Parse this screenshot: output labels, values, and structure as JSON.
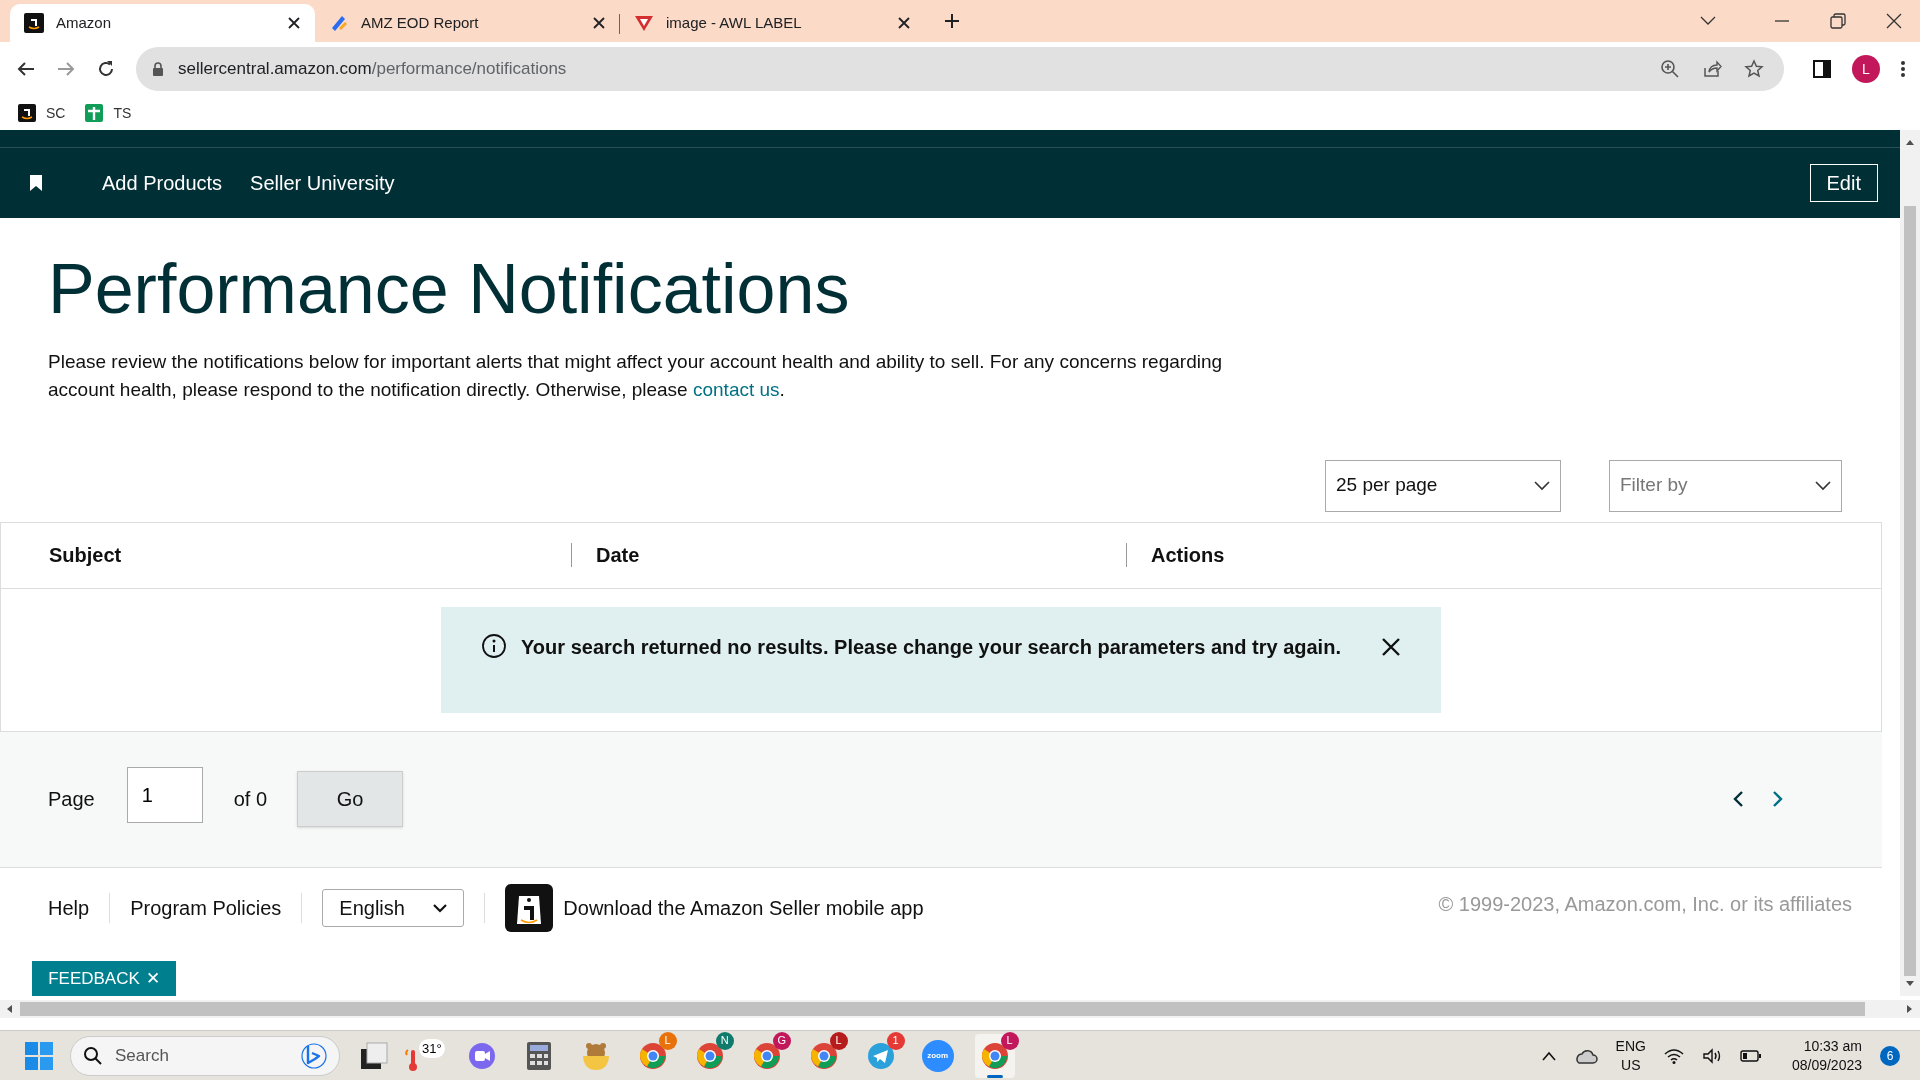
{
  "browser": {
    "tabs": [
      {
        "title": "Amazon",
        "selected": true,
        "kind": "amazon"
      },
      {
        "title": "AMZ EOD Report",
        "selected": false,
        "kind": "report"
      },
      {
        "title": "image - AWL LABEL",
        "selected": false,
        "kind": "awl"
      }
    ],
    "address": {
      "host": "sellercentral.amazon.com",
      "path": "/performance/notifications"
    },
    "profile": "L",
    "bookmarks": [
      {
        "label": "SC",
        "kind": "amazon"
      },
      {
        "label": "TS",
        "kind": "sheet"
      }
    ]
  },
  "nav": {
    "items": [
      "Add Products",
      "Seller University"
    ],
    "edit": "Edit"
  },
  "page": {
    "title": "Performance Notifications",
    "description": "Please review the notifications below for important alerts that might affect your account health and ability to sell. For any concerns regarding account health, please respond to the notification directly. Otherwise, please ",
    "link": "contact us",
    "after_link": ".",
    "per_page": "25 per page",
    "filter_placeholder": "Filter by"
  },
  "table": {
    "columns": [
      "Subject",
      "Date",
      "Actions"
    ],
    "alert": "Your search returned no results. Please change your search parameters and try again."
  },
  "pagination": {
    "label": "Page",
    "value": "1",
    "of": "of 0",
    "go": "Go"
  },
  "footer": {
    "links": [
      "Help",
      "Program Policies"
    ],
    "language": "English",
    "app": "Download the Amazon Seller mobile app",
    "copyright": "© 1999-2023, Amazon.com, Inc. or its affiliates",
    "feedback": "FEEDBACK",
    "feedback_close": "✕"
  },
  "taskbar": {
    "search": "Search",
    "weather": "31°",
    "apps": [
      {
        "kind": "meet"
      },
      {
        "kind": "calculator"
      },
      {
        "kind": "bear"
      },
      {
        "kind": "chrome",
        "badge": "L",
        "color": "#e8710a"
      },
      {
        "kind": "chrome",
        "badge": "N",
        "color": "#0f7b6c"
      },
      {
        "kind": "chrome",
        "badge": "G",
        "color": "#c2185b"
      },
      {
        "kind": "chrome",
        "badge": "L",
        "color": "#b71c1c"
      },
      {
        "kind": "telegram",
        "badge": "1",
        "color": "#e53935"
      },
      {
        "kind": "zoom",
        "label": "zoom"
      },
      {
        "kind": "chrome",
        "badge": "L",
        "color": "#c2185b",
        "selected": true
      }
    ],
    "lang": "ENG",
    "region": "US",
    "time": "10:33 am",
    "date": "08/09/2023",
    "notifications": "6"
  }
}
